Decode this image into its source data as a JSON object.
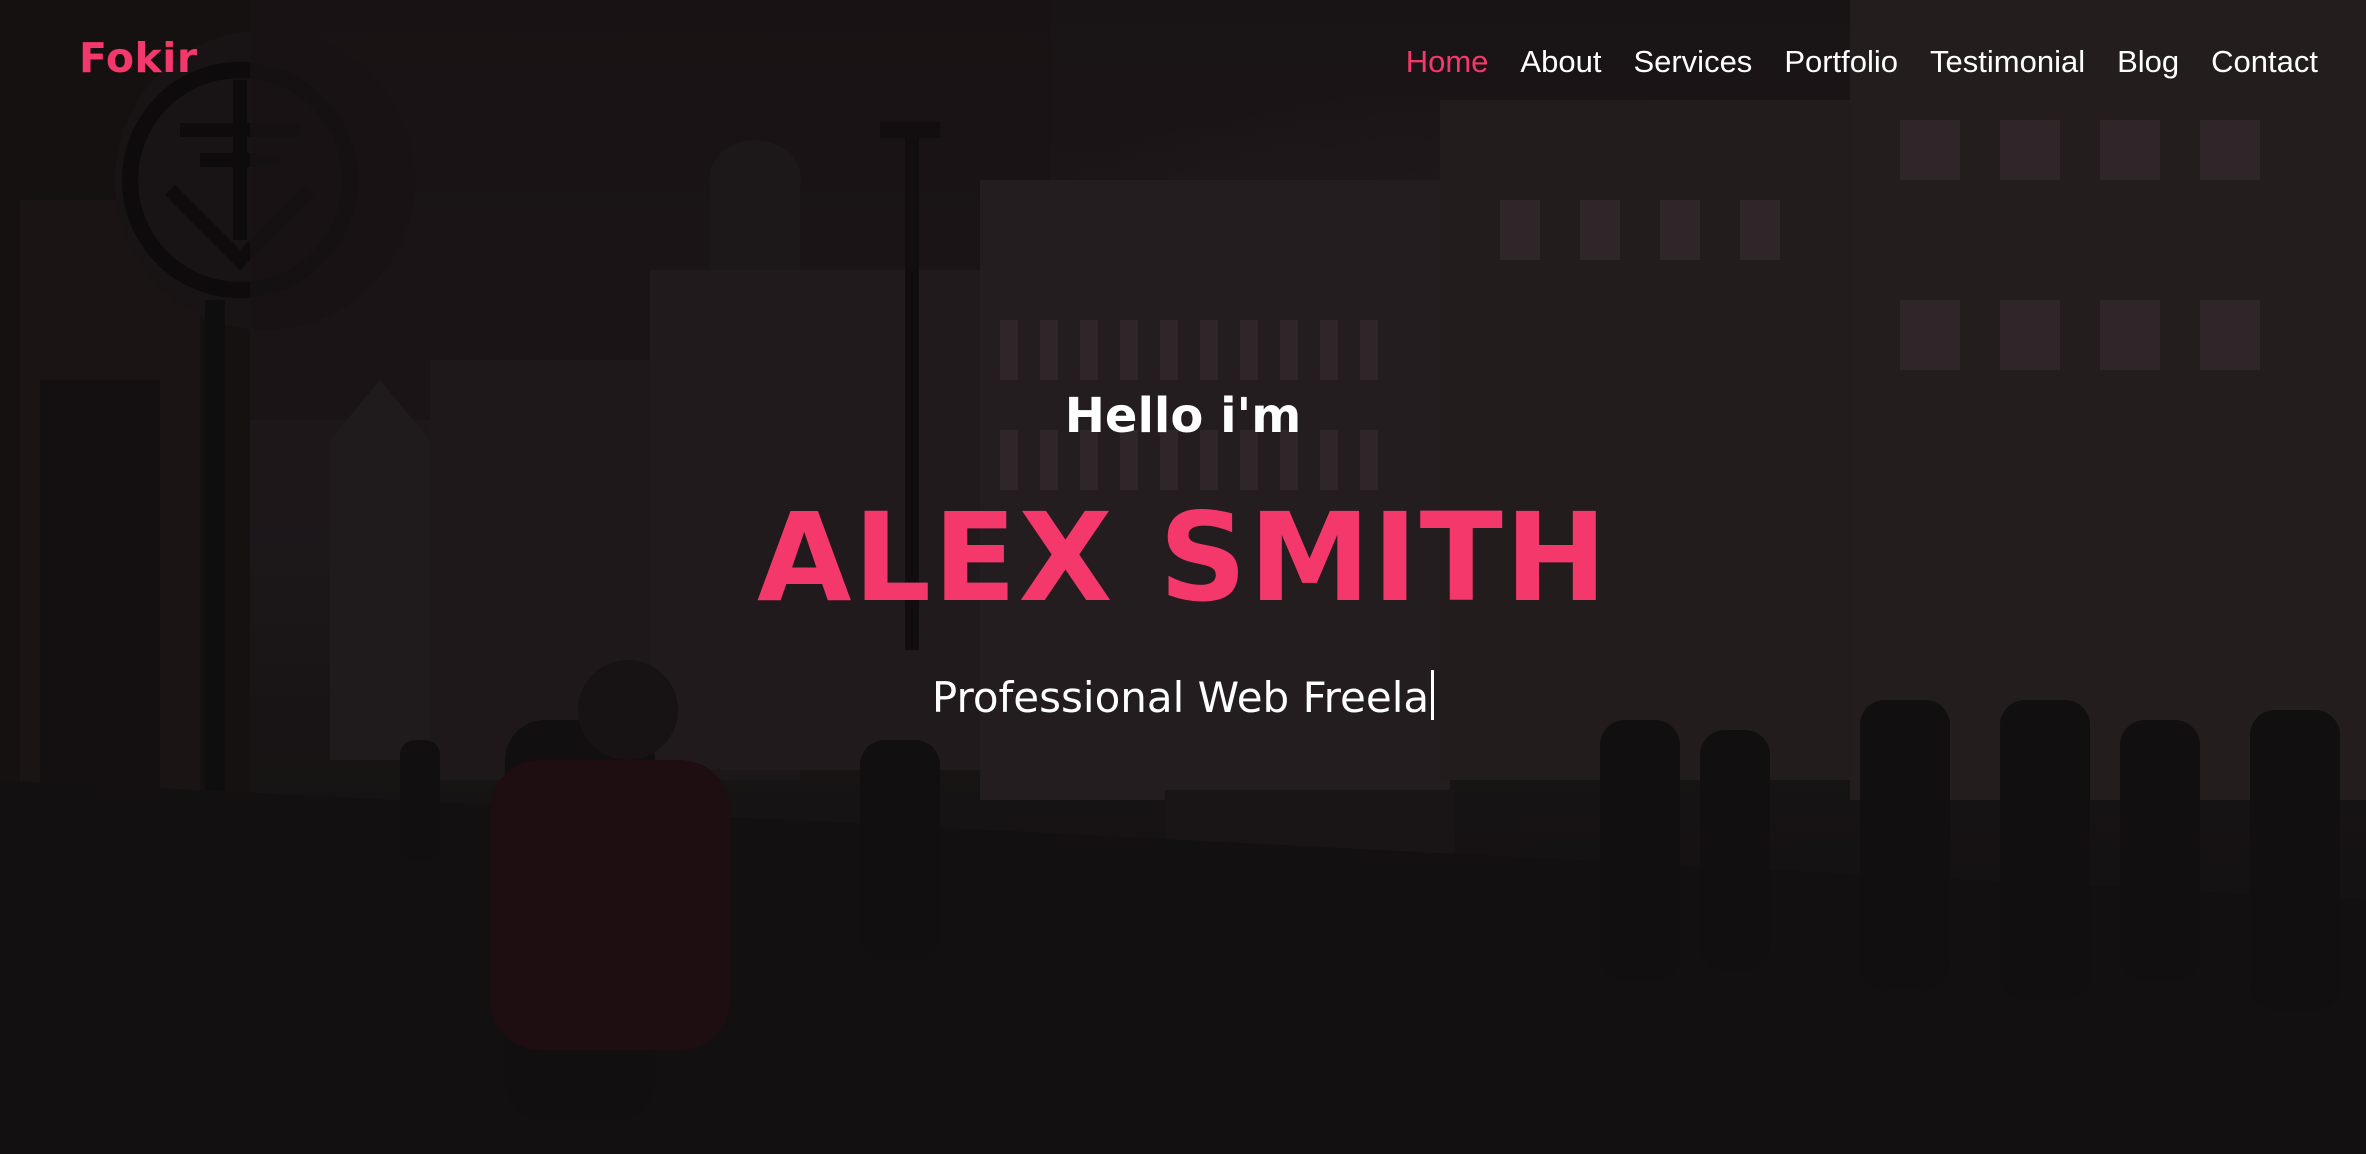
{
  "brand": {
    "logo": "Fokir",
    "accent_color": "#f4386b"
  },
  "nav": {
    "items": [
      {
        "label": "Home",
        "active": true
      },
      {
        "label": "About",
        "active": false
      },
      {
        "label": "Services",
        "active": false
      },
      {
        "label": "Portfolio",
        "active": false
      },
      {
        "label": "Testimonial",
        "active": false
      },
      {
        "label": "Blog",
        "active": false
      },
      {
        "label": "Contact",
        "active": false
      }
    ]
  },
  "hero": {
    "greeting": "Hello i'm",
    "name": "ALEX SMITH",
    "typed_text": "Professional Web Freela",
    "background": "dark city street photo with overlay"
  }
}
